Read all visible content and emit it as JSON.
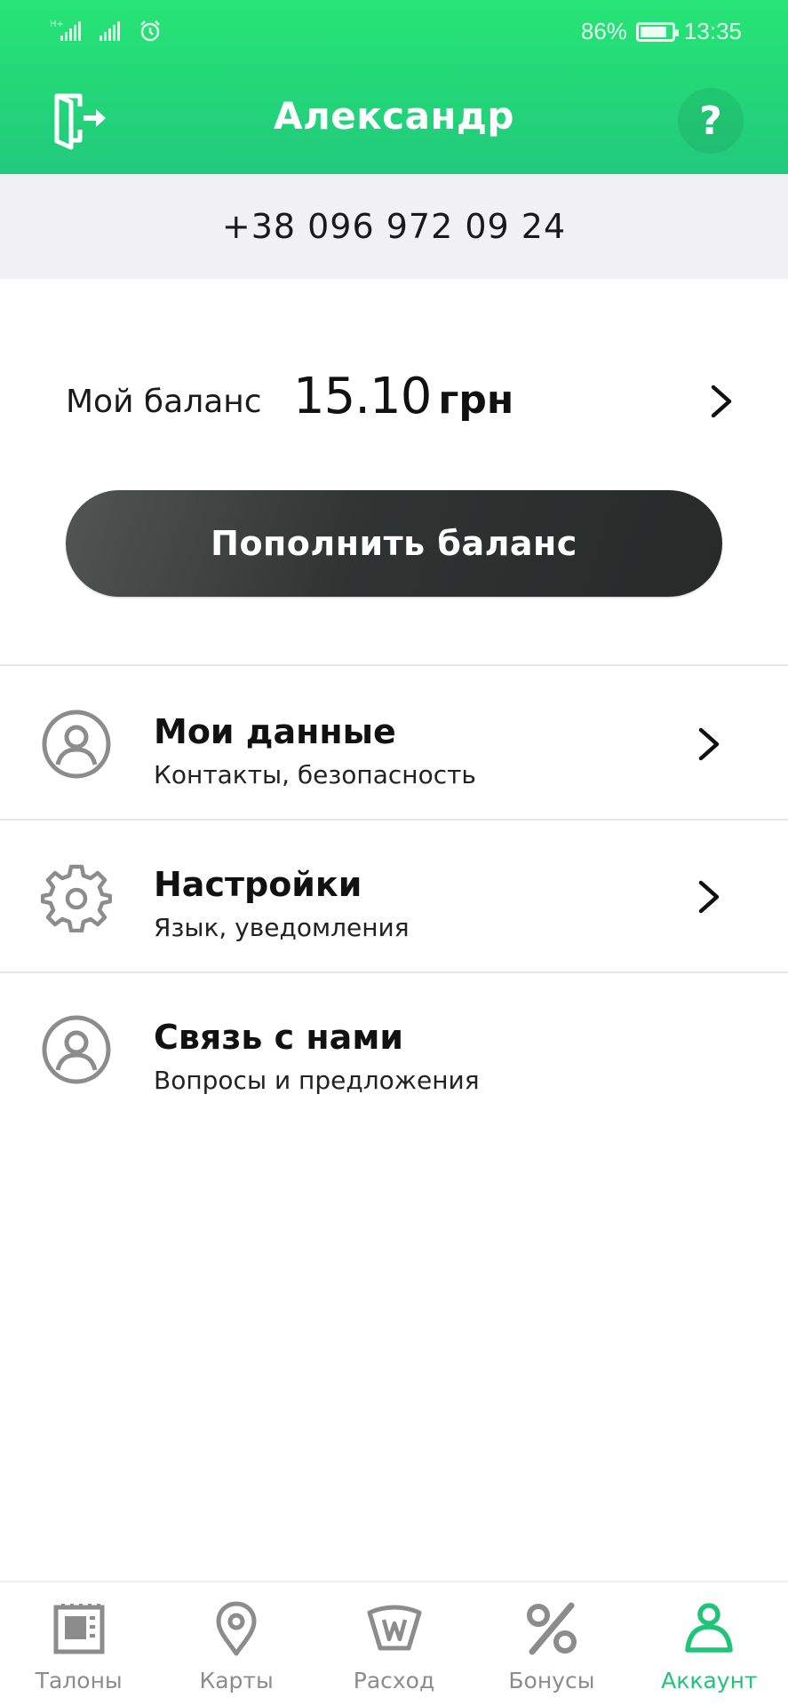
{
  "status_bar": {
    "network_label": "H+",
    "battery_percent": "86%",
    "battery_level": 0.86,
    "time": "13:35"
  },
  "header": {
    "title": "Александр",
    "help_label": "?",
    "logout_icon": "logout-door-icon"
  },
  "phone": "+38 096 972 09 24",
  "balance": {
    "label": "Мой баланс",
    "amount": "15.10",
    "currency": "грн"
  },
  "topup_button": "Пополнить баланс",
  "menu": [
    {
      "title": "Мои данные",
      "subtitle": "Контакты, безопасность",
      "icon": "user-circle-icon",
      "has_chevron": true
    },
    {
      "title": "Настройки",
      "subtitle": "Язык, уведомления",
      "icon": "gear-icon",
      "has_chevron": true
    },
    {
      "title": "Связь с нами",
      "subtitle": "Вопросы и предложения",
      "icon": "user-circle-icon",
      "has_chevron": false
    }
  ],
  "bottom_nav": [
    {
      "label": "Талоны",
      "icon": "ticket-icon",
      "active": false
    },
    {
      "label": "Карты",
      "icon": "map-pin-icon",
      "active": false
    },
    {
      "label": "Расход",
      "icon": "fuel-gauge-icon",
      "active": false
    },
    {
      "label": "Бонусы",
      "icon": "percent-icon",
      "active": false
    },
    {
      "label": "Аккаунт",
      "icon": "account-icon",
      "active": true
    }
  ],
  "colors": {
    "header_top": "#26e575",
    "header_bottom": "#22c97c",
    "active_nav": "#20c478",
    "button_dark": "#2f3332"
  }
}
